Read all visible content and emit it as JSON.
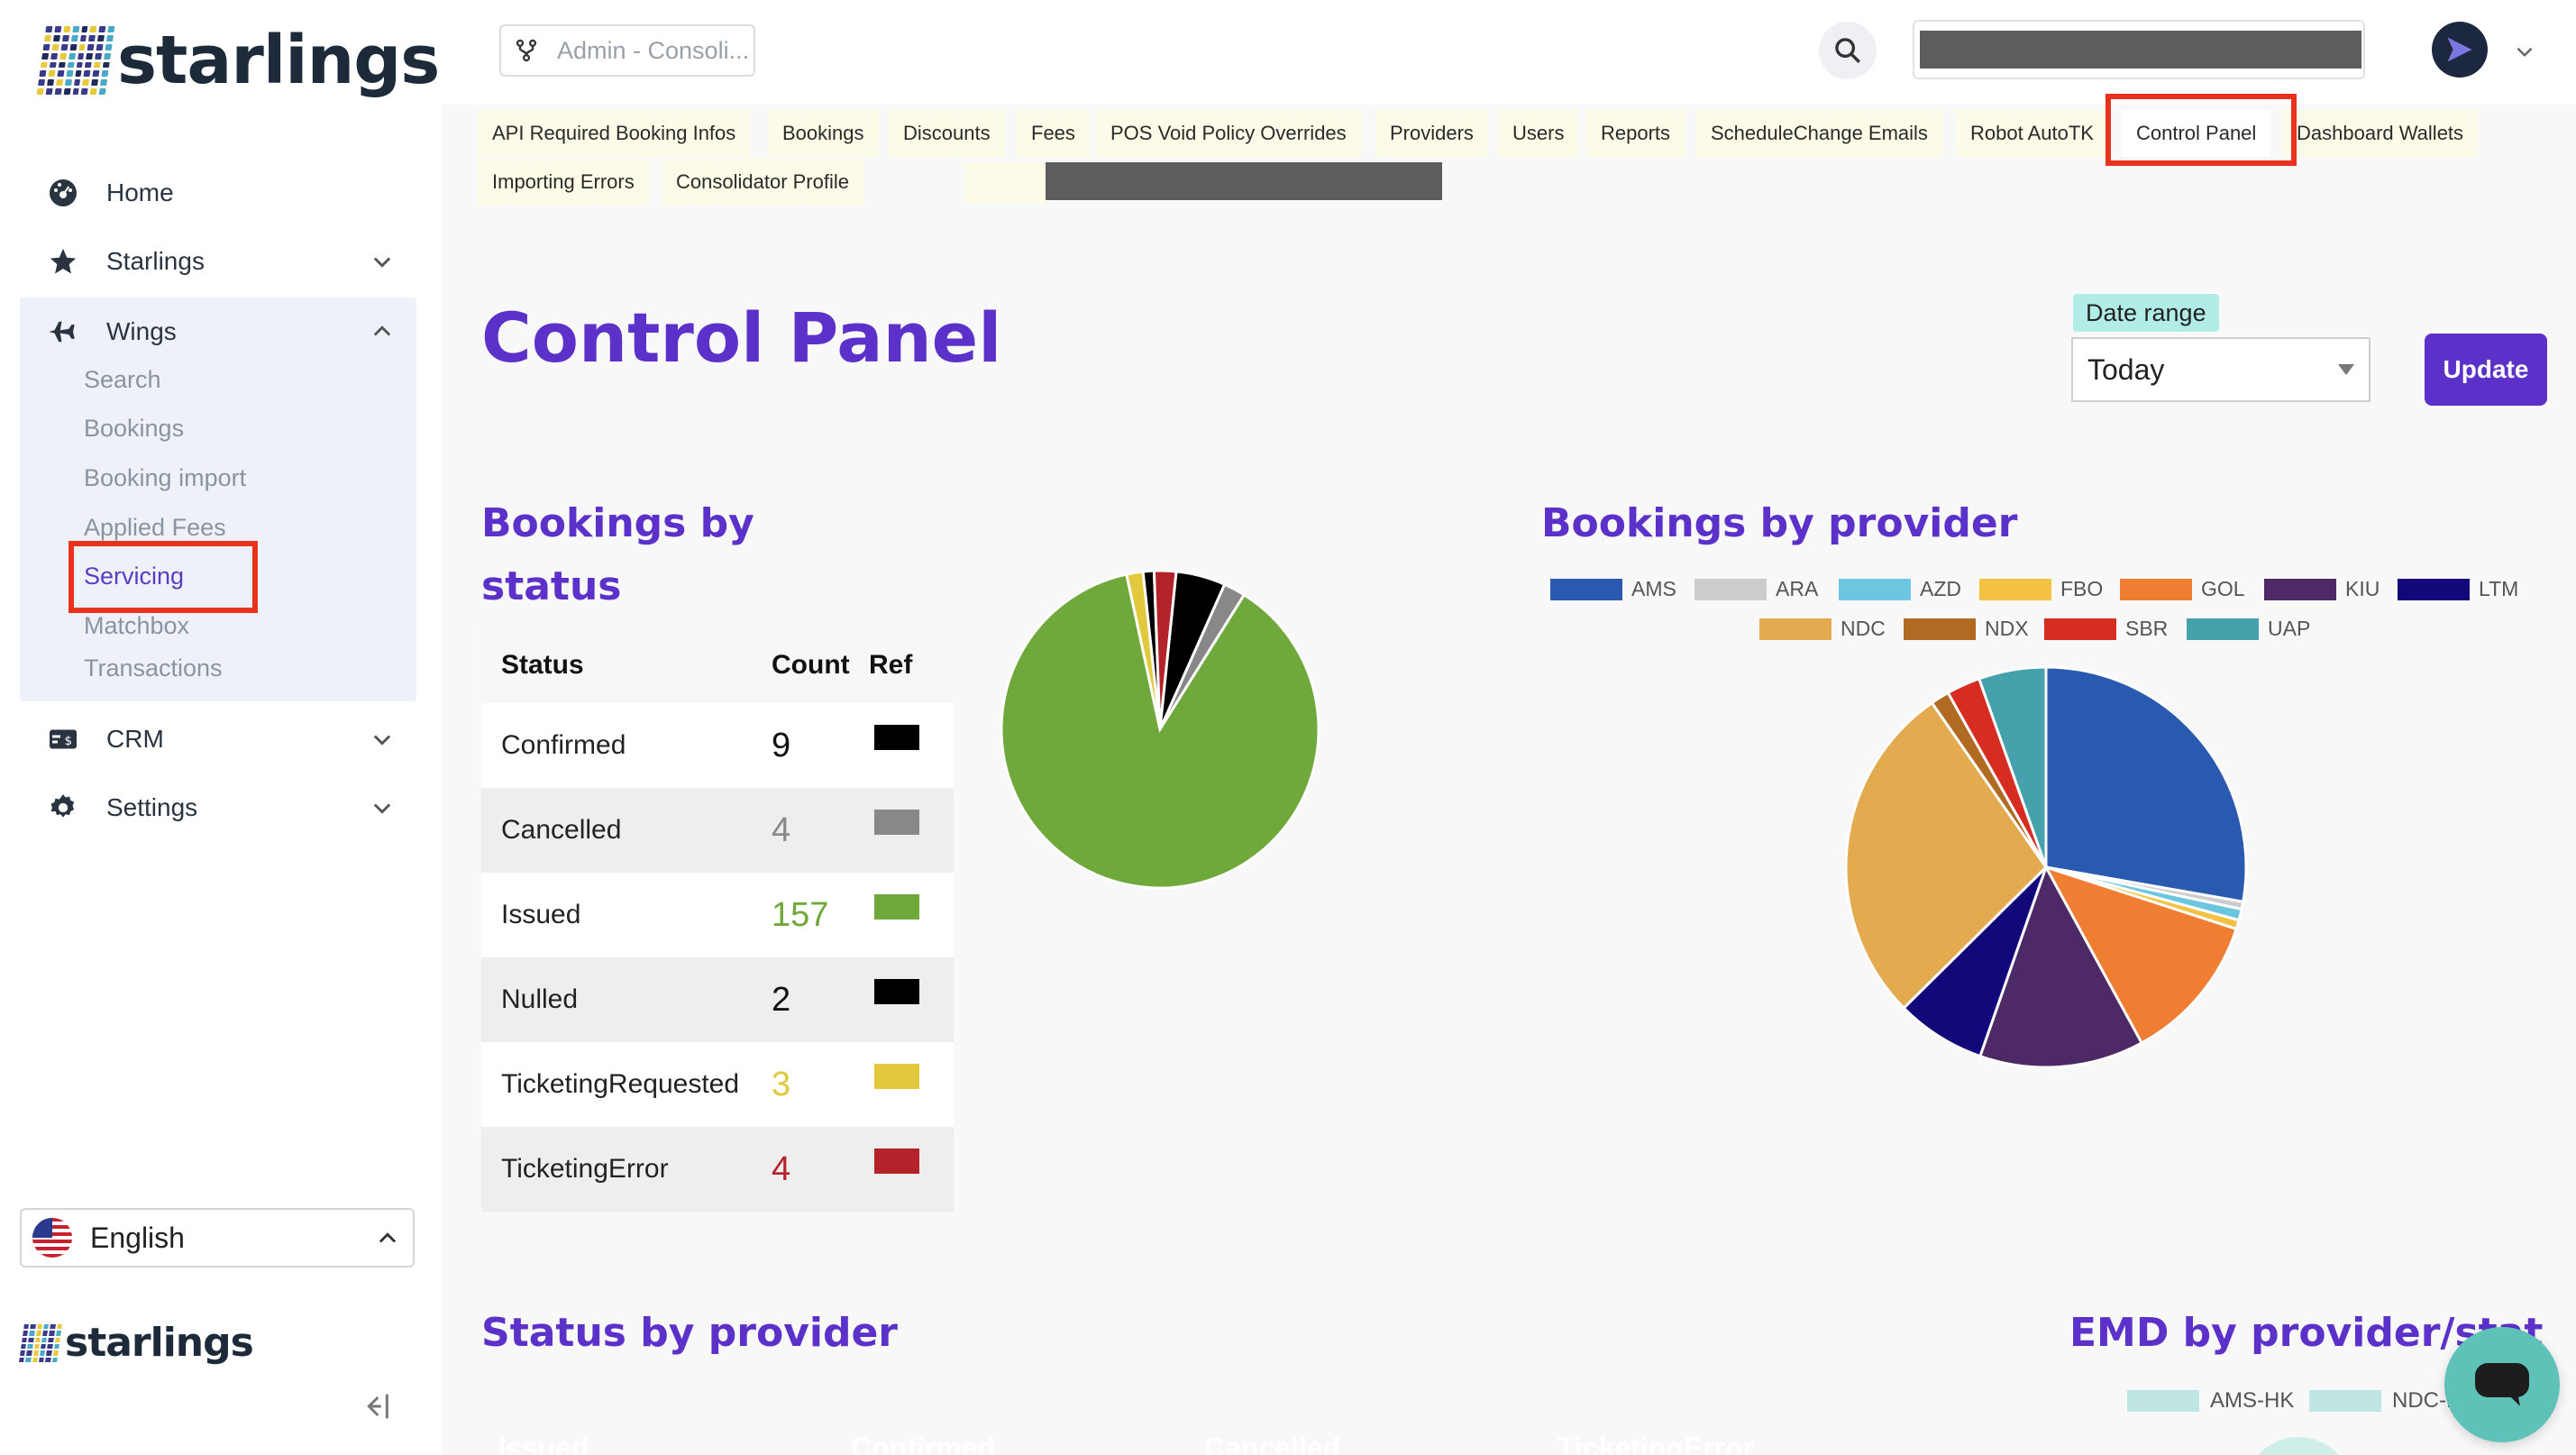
{
  "brand": {
    "name": "starlings"
  },
  "sidebar": {
    "items": [
      {
        "label": "Home",
        "icon": "dashboard-icon"
      },
      {
        "label": "Starlings",
        "icon": "star-icon"
      },
      {
        "label": "Wings",
        "icon": "airplane-icon"
      },
      {
        "label": "CRM",
        "icon": "money-card-icon"
      },
      {
        "label": "Settings",
        "icon": "gear-icon"
      }
    ],
    "wings_sub": [
      "Search",
      "Bookings",
      "Booking import",
      "Applied Fees",
      "Servicing",
      "Matchbox",
      "Transactions"
    ],
    "active_sub": "Servicing",
    "language": "English"
  },
  "header": {
    "admin_select": "Admin - Consoli..."
  },
  "tabs": {
    "row1": [
      "API Required Booking Infos",
      "Bookings",
      "Discounts",
      "Fees",
      "POS Void Policy Overrides",
      "Providers",
      "Users",
      "Reports",
      "ScheduleChange Emails",
      "Robot AutoTK",
      "Control Panel",
      "Dashboard Wallets"
    ],
    "row2": [
      "Importing Errors",
      "Consolidator Profile"
    ],
    "active": "Control Panel"
  },
  "page": {
    "title": "Control Panel",
    "date_range_label": "Date range",
    "date_range_value": "Today",
    "update_label": "Update"
  },
  "status_section": {
    "title_line1": "Bookings by",
    "title_line2": "status",
    "headers": [
      "Status",
      "Count",
      "Ref"
    ],
    "rows": [
      {
        "status": "Confirmed",
        "count": "9",
        "color": "#000000",
        "count_color": "#111111"
      },
      {
        "status": "Cancelled",
        "count": "4",
        "color": "#888888",
        "count_color": "#888888"
      },
      {
        "status": "Issued",
        "count": "157",
        "color": "#6fa83b",
        "count_color": "#6fa83b"
      },
      {
        "status": "Nulled",
        "count": "2",
        "color": "#000000",
        "count_color": "#111111"
      },
      {
        "status": "TicketingRequested",
        "count": "3",
        "color": "#e2c83c",
        "count_color": "#e2c83c"
      },
      {
        "status": "TicketingError",
        "count": "4",
        "color": "#b5232a",
        "count_color": "#b5232a"
      }
    ]
  },
  "provider_section": {
    "title": "Bookings by provider",
    "legend": [
      {
        "name": "AMS",
        "color": "#2a5ab0"
      },
      {
        "name": "ARA",
        "color": "#cccccc"
      },
      {
        "name": "AZD",
        "color": "#6cc6e0"
      },
      {
        "name": "FBO",
        "color": "#f4c242"
      },
      {
        "name": "GOL",
        "color": "#ef7d32"
      },
      {
        "name": "KIU",
        "color": "#4d2a66"
      },
      {
        "name": "LTM",
        "color": "#12087a"
      },
      {
        "name": "NDC",
        "color": "#e3aa4f"
      },
      {
        "name": "NDX",
        "color": "#b06a22"
      },
      {
        "name": "SBR",
        "color": "#d62c22"
      },
      {
        "name": "UAP",
        "color": "#45a2ac"
      }
    ]
  },
  "chart_data": [
    {
      "type": "pie",
      "categories": [
        "Confirmed",
        "Cancelled",
        "Issued",
        "Nulled",
        "TicketingRequested",
        "TicketingError"
      ],
      "values": [
        9,
        4,
        157,
        2,
        3,
        4
      ],
      "colors": [
        "#000000",
        "#888888",
        "#6fa83b",
        "#000000",
        "#e2c83c",
        "#b5232a"
      ]
    },
    {
      "type": "pie",
      "categories": [
        "AMS",
        "ARA",
        "AZD",
        "FBO",
        "GOL",
        "KIU",
        "LTM",
        "NDC",
        "NDX",
        "SBR",
        "UAP"
      ],
      "values": [
        46,
        1,
        1.5,
        1.2,
        20,
        22,
        12,
        46,
        2.5,
        4.5,
        9
      ],
      "colors": [
        "#2a5ab0",
        "#cccccc",
        "#6cc6e0",
        "#f4c242",
        "#ef7d32",
        "#4d2a66",
        "#12087a",
        "#e3aa4f",
        "#b06a22",
        "#d62c22",
        "#45a2ac"
      ]
    }
  ],
  "lower": {
    "status_by_provider_title": "Status by provider",
    "emd_title": "EMD by provider/stat",
    "cards": [
      {
        "label": "Issued",
        "color": "#6fa83b"
      },
      {
        "label": "Confirmed",
        "color": "#111111"
      },
      {
        "label": "Cancelled",
        "color": "#888888"
      },
      {
        "label": "TicketingError",
        "color": "#b5232a"
      }
    ],
    "emd_legend": [
      "AMS-HK",
      "NDC-H"
    ]
  }
}
